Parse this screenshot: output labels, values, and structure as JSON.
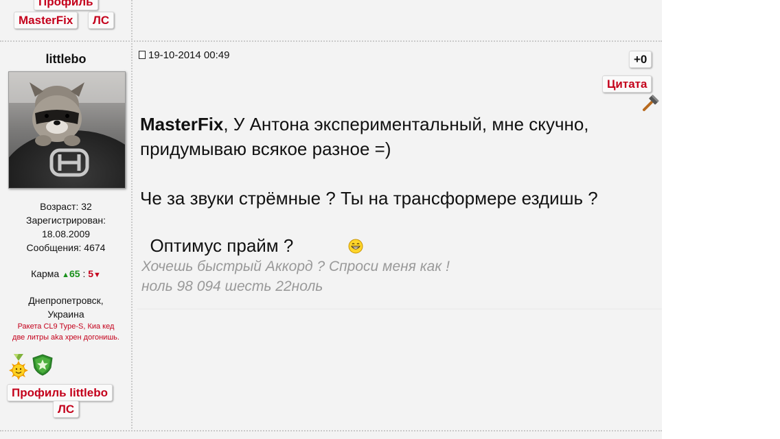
{
  "prev_post": {
    "profile_label": "Профиль",
    "profile_name": "MasterFix",
    "pm_label": "ЛС"
  },
  "author": {
    "username": "littlebo",
    "age": "Возраст: 32",
    "registered_label": "Зарегистрирован:",
    "registered_date": "18.08.2009",
    "messages": "Сообщения: 4674",
    "karma_label": "Карма",
    "karma_plus": "65",
    "karma_separator": ":",
    "karma_minus": "5",
    "city": "Днепропетровск,",
    "country": "Украина",
    "custom_line1": "Ракета CL9 Type-S, Киа кед",
    "custom_line2": "две литры aka хрен догонишь.",
    "profile_button": "Профиль littlebo",
    "pm_button": "ЛС"
  },
  "post": {
    "date": "19-10-2014 00:49",
    "rating": "+0",
    "quote_button": "Цитата",
    "addressee": "MasterFix",
    "text_line1": ", У Антона экспериментальный, мне скучно,",
    "text_line2": "придумываю всякое разное =)",
    "text_line3": "Че за звуки стрёмные ?  Ты на трансформере ездишь ?",
    "text_line4": "  Оптимус прайм ?",
    "signature_line1": "Хочешь быстрый Аккорд ? Спроси меня как !",
    "signature_line2": "ноль 98 094 шесть 22ноль"
  },
  "icons": {
    "hammer": "hammer-icon",
    "smiley": "laughing-smiley-icon",
    "award_sun": "sun-medal-icon",
    "award_star": "green-star-shield-icon"
  },
  "colors": {
    "accent_red": "#c4001b",
    "karma_green": "#18911a",
    "signature_gray": "#999999",
    "background": "#f3f3f3"
  }
}
